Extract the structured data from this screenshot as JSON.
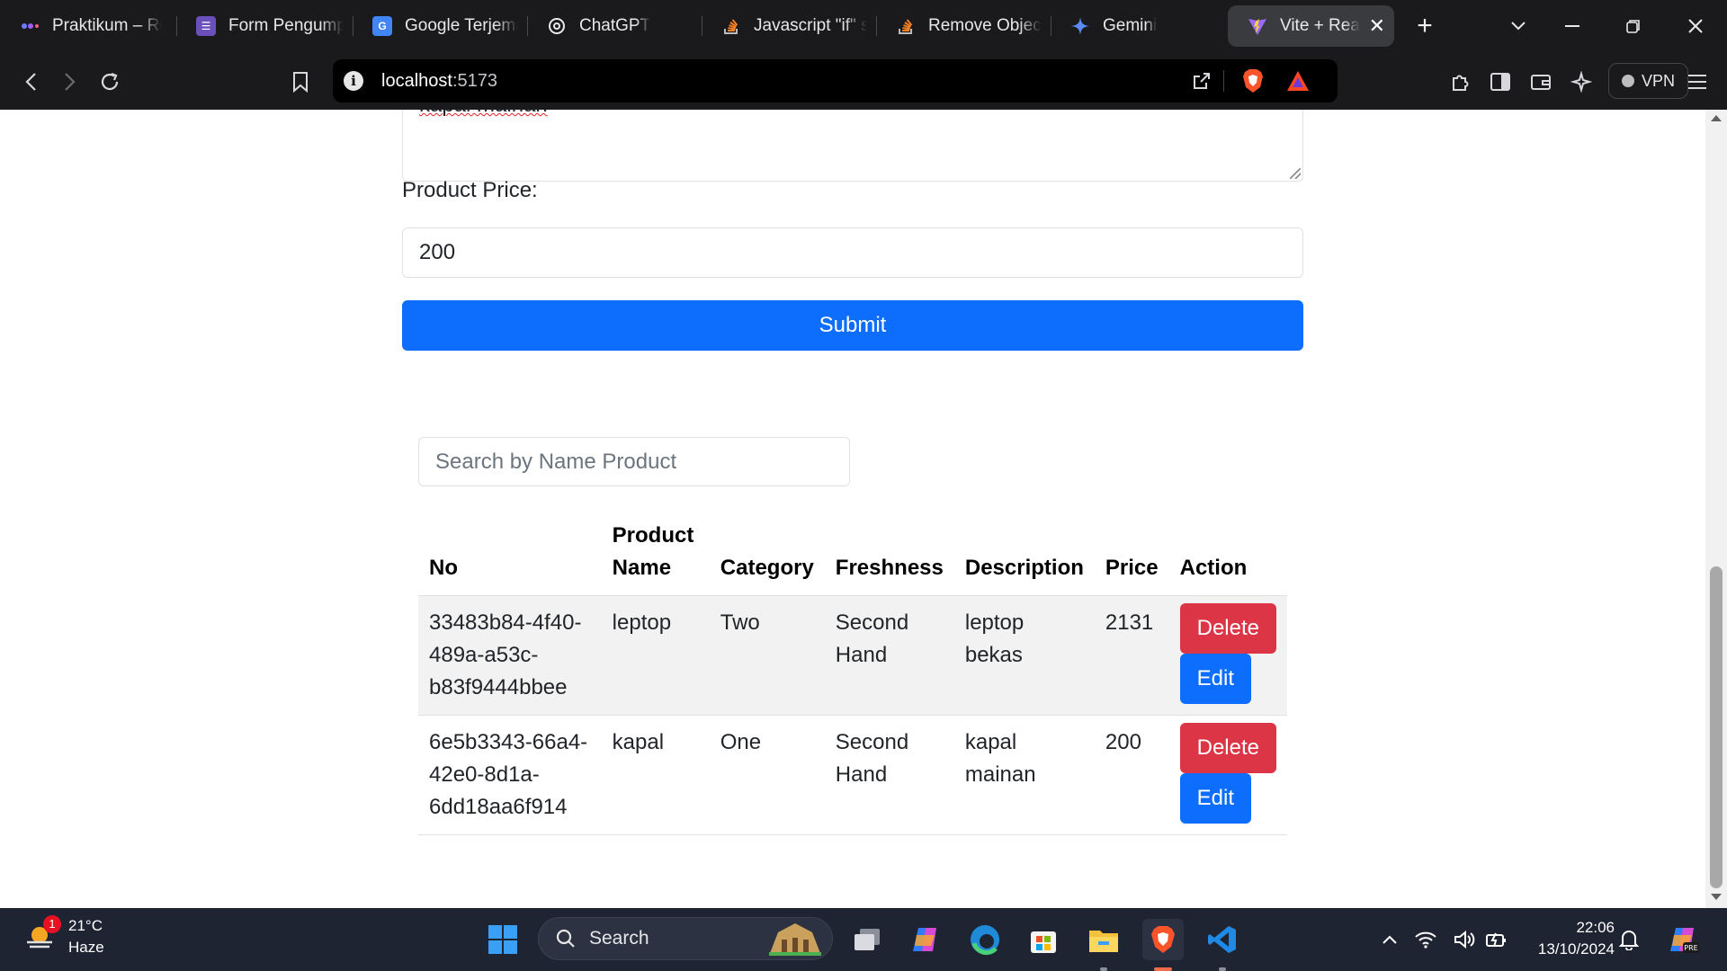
{
  "browser": {
    "tabs": [
      {
        "label": "Praktikum – Re",
        "icon": "orb-icon"
      },
      {
        "label": "Form Pengump",
        "icon": "forms-icon"
      },
      {
        "label": "Google Terjema",
        "icon": "translate-icon"
      },
      {
        "label": "ChatGPT",
        "icon": "chatgpt-icon"
      },
      {
        "label": "Javascript \"if\" s",
        "icon": "stackoverflow-icon"
      },
      {
        "label": "Remove Object",
        "icon": "stackoverflow-icon"
      },
      {
        "label": "Gemini",
        "icon": "gemini-icon"
      },
      {
        "label": "Vite + Rea",
        "icon": "vite-icon",
        "active": true
      }
    ],
    "new_tab": "+",
    "url_host": "localhost",
    "url_port": ":5173",
    "vpn_label": "VPN"
  },
  "form": {
    "description_value_partial": "kapal mainan",
    "price_label": "Product Price:",
    "price_value": "200",
    "submit_label": "Submit"
  },
  "search": {
    "placeholder": "Search by Name Product"
  },
  "table": {
    "headers": [
      "No",
      "Product Name",
      "Category",
      "Freshness",
      "Description",
      "Price",
      "Action"
    ],
    "header_name_line1": "Product",
    "header_name_line2": "Name",
    "rows": [
      {
        "id_l1": "33483b84-4f40-",
        "id_l2": "489a-a53c-",
        "id_l3": "b83f9444bbee",
        "name": "leptop",
        "category": "Two",
        "fresh_l1": "Second",
        "fresh_l2": "Hand",
        "desc_l1": "leptop",
        "desc_l2": "bekas",
        "price": "2131"
      },
      {
        "id_l1": "6e5b3343-66a4-",
        "id_l2": "42e0-8d1a-",
        "id_l3": "6dd18aa6f914",
        "name": "kapal",
        "category": "One",
        "fresh_l1": "Second",
        "fresh_l2": "Hand",
        "desc_l1": "kapal",
        "desc_l2": "mainan",
        "price": "200"
      }
    ],
    "delete_label": "Delete",
    "edit_label": "Edit"
  },
  "taskbar": {
    "weather_temp": "21°C",
    "weather_desc": "Haze",
    "weather_badge": "1",
    "search_label": "Search",
    "time": "22:06",
    "date": "13/10/2024"
  },
  "colors": {
    "primary": "#0d6efd",
    "danger": "#dc3545",
    "browser_chrome": "#1a1a1c",
    "taskbar": "#1f2433"
  }
}
